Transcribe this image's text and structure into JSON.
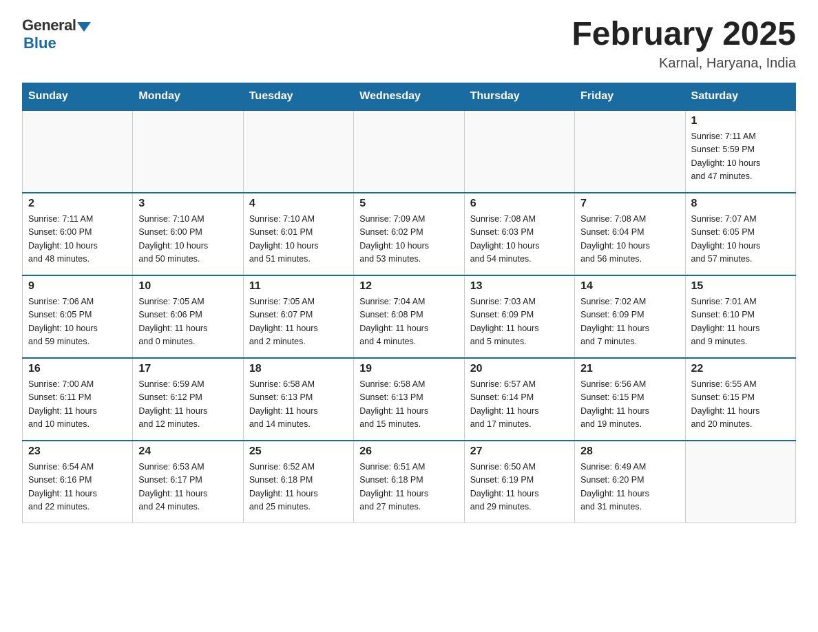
{
  "header": {
    "logo_general": "General",
    "logo_blue": "Blue",
    "month_title": "February 2025",
    "location": "Karnal, Haryana, India"
  },
  "days_of_week": [
    "Sunday",
    "Monday",
    "Tuesday",
    "Wednesday",
    "Thursday",
    "Friday",
    "Saturday"
  ],
  "weeks": [
    [
      {
        "day": "",
        "info": ""
      },
      {
        "day": "",
        "info": ""
      },
      {
        "day": "",
        "info": ""
      },
      {
        "day": "",
        "info": ""
      },
      {
        "day": "",
        "info": ""
      },
      {
        "day": "",
        "info": ""
      },
      {
        "day": "1",
        "info": "Sunrise: 7:11 AM\nSunset: 5:59 PM\nDaylight: 10 hours\nand 47 minutes."
      }
    ],
    [
      {
        "day": "2",
        "info": "Sunrise: 7:11 AM\nSunset: 6:00 PM\nDaylight: 10 hours\nand 48 minutes."
      },
      {
        "day": "3",
        "info": "Sunrise: 7:10 AM\nSunset: 6:00 PM\nDaylight: 10 hours\nand 50 minutes."
      },
      {
        "day": "4",
        "info": "Sunrise: 7:10 AM\nSunset: 6:01 PM\nDaylight: 10 hours\nand 51 minutes."
      },
      {
        "day": "5",
        "info": "Sunrise: 7:09 AM\nSunset: 6:02 PM\nDaylight: 10 hours\nand 53 minutes."
      },
      {
        "day": "6",
        "info": "Sunrise: 7:08 AM\nSunset: 6:03 PM\nDaylight: 10 hours\nand 54 minutes."
      },
      {
        "day": "7",
        "info": "Sunrise: 7:08 AM\nSunset: 6:04 PM\nDaylight: 10 hours\nand 56 minutes."
      },
      {
        "day": "8",
        "info": "Sunrise: 7:07 AM\nSunset: 6:05 PM\nDaylight: 10 hours\nand 57 minutes."
      }
    ],
    [
      {
        "day": "9",
        "info": "Sunrise: 7:06 AM\nSunset: 6:05 PM\nDaylight: 10 hours\nand 59 minutes."
      },
      {
        "day": "10",
        "info": "Sunrise: 7:05 AM\nSunset: 6:06 PM\nDaylight: 11 hours\nand 0 minutes."
      },
      {
        "day": "11",
        "info": "Sunrise: 7:05 AM\nSunset: 6:07 PM\nDaylight: 11 hours\nand 2 minutes."
      },
      {
        "day": "12",
        "info": "Sunrise: 7:04 AM\nSunset: 6:08 PM\nDaylight: 11 hours\nand 4 minutes."
      },
      {
        "day": "13",
        "info": "Sunrise: 7:03 AM\nSunset: 6:09 PM\nDaylight: 11 hours\nand 5 minutes."
      },
      {
        "day": "14",
        "info": "Sunrise: 7:02 AM\nSunset: 6:09 PM\nDaylight: 11 hours\nand 7 minutes."
      },
      {
        "day": "15",
        "info": "Sunrise: 7:01 AM\nSunset: 6:10 PM\nDaylight: 11 hours\nand 9 minutes."
      }
    ],
    [
      {
        "day": "16",
        "info": "Sunrise: 7:00 AM\nSunset: 6:11 PM\nDaylight: 11 hours\nand 10 minutes."
      },
      {
        "day": "17",
        "info": "Sunrise: 6:59 AM\nSunset: 6:12 PM\nDaylight: 11 hours\nand 12 minutes."
      },
      {
        "day": "18",
        "info": "Sunrise: 6:58 AM\nSunset: 6:13 PM\nDaylight: 11 hours\nand 14 minutes."
      },
      {
        "day": "19",
        "info": "Sunrise: 6:58 AM\nSunset: 6:13 PM\nDaylight: 11 hours\nand 15 minutes."
      },
      {
        "day": "20",
        "info": "Sunrise: 6:57 AM\nSunset: 6:14 PM\nDaylight: 11 hours\nand 17 minutes."
      },
      {
        "day": "21",
        "info": "Sunrise: 6:56 AM\nSunset: 6:15 PM\nDaylight: 11 hours\nand 19 minutes."
      },
      {
        "day": "22",
        "info": "Sunrise: 6:55 AM\nSunset: 6:15 PM\nDaylight: 11 hours\nand 20 minutes."
      }
    ],
    [
      {
        "day": "23",
        "info": "Sunrise: 6:54 AM\nSunset: 6:16 PM\nDaylight: 11 hours\nand 22 minutes."
      },
      {
        "day": "24",
        "info": "Sunrise: 6:53 AM\nSunset: 6:17 PM\nDaylight: 11 hours\nand 24 minutes."
      },
      {
        "day": "25",
        "info": "Sunrise: 6:52 AM\nSunset: 6:18 PM\nDaylight: 11 hours\nand 25 minutes."
      },
      {
        "day": "26",
        "info": "Sunrise: 6:51 AM\nSunset: 6:18 PM\nDaylight: 11 hours\nand 27 minutes."
      },
      {
        "day": "27",
        "info": "Sunrise: 6:50 AM\nSunset: 6:19 PM\nDaylight: 11 hours\nand 29 minutes."
      },
      {
        "day": "28",
        "info": "Sunrise: 6:49 AM\nSunset: 6:20 PM\nDaylight: 11 hours\nand 31 minutes."
      },
      {
        "day": "",
        "info": ""
      }
    ]
  ]
}
